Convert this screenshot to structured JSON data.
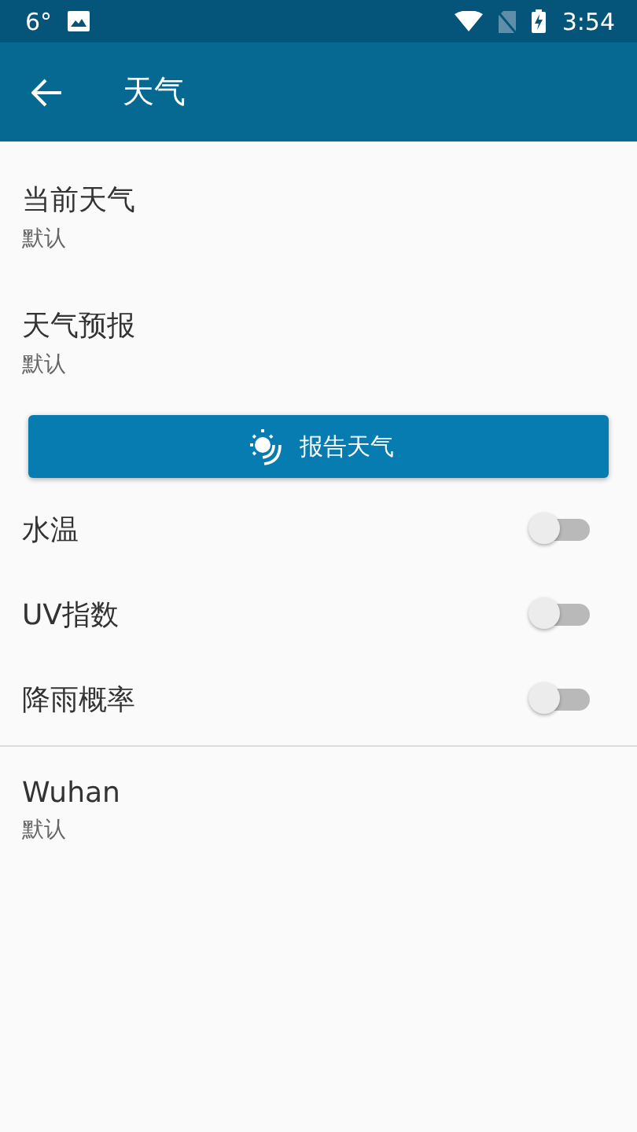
{
  "status_bar": {
    "temperature": "6°",
    "time": "3:54"
  },
  "app_bar": {
    "title": "天气"
  },
  "settings": [
    {
      "title": "当前天气",
      "summary": "默认"
    },
    {
      "title": "天气预报",
      "summary": "默认"
    }
  ],
  "report_button": {
    "label": "报告天气"
  },
  "toggles": [
    {
      "label": "水温",
      "on": false
    },
    {
      "label": "UV指数",
      "on": false
    },
    {
      "label": "降雨概率",
      "on": false
    }
  ],
  "locations": [
    {
      "title": "Wuhan",
      "summary": "默认"
    }
  ]
}
